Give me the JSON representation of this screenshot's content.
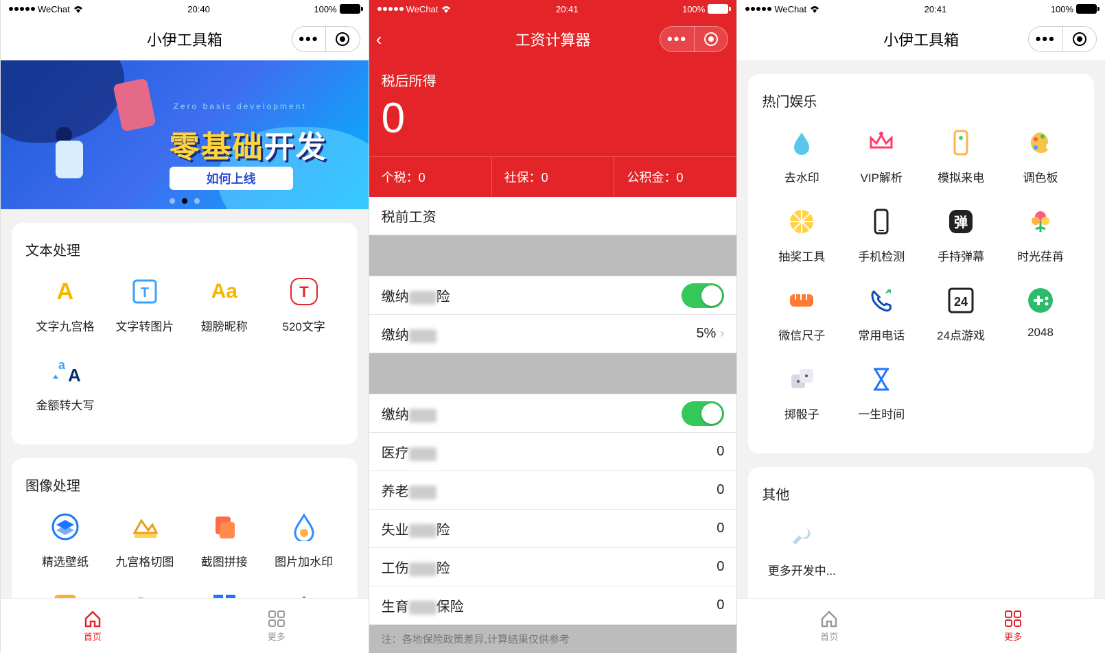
{
  "status": {
    "carrier": "WeChat",
    "time1": "20:40",
    "time2": "20:41",
    "time3": "20:41",
    "battery": "100%"
  },
  "screen1": {
    "title": "小伊工具箱",
    "banner_line1": "零基础",
    "banner_line2": "开发",
    "banner_sub": "Zero basic development",
    "banner_btn": "如何上线",
    "sec1_title": "文本处理",
    "sec1_items": [
      {
        "label": "文字九宫格"
      },
      {
        "label": "文字转图片"
      },
      {
        "label": "翅膀昵称"
      },
      {
        "label": "520文字"
      },
      {
        "label": "金额转大写"
      }
    ],
    "sec2_title": "图像处理",
    "sec2_items": [
      {
        "label": "精选壁纸"
      },
      {
        "label": "九宫格切图"
      },
      {
        "label": "截图拼接"
      },
      {
        "label": "图片加水印"
      }
    ],
    "tabs": {
      "home": "首页",
      "more": "更多"
    }
  },
  "screen2": {
    "title": "工资计算器",
    "net_label": "税后所得",
    "net_value": "0",
    "tax_label": "个税：",
    "tax_value": "0",
    "social_label": "社保：",
    "social_value": "0",
    "fund_label": "公积金：",
    "fund_value": "0",
    "row_pre_salary": "税前工资",
    "row_pay1": "缴纳",
    "row_pay2": "缴纳",
    "row_pay2_val": "5%",
    "row_pay3": "缴纳",
    "row_med": "医疗",
    "row_pension": "养老",
    "row_unemp": "失业",
    "row_injury": "工伤",
    "row_birth": "生育",
    "zero": "0",
    "suffix_ins": "险",
    "suffix_ins2": "保险",
    "note": "注：各地保险政策差异,计算结果仅供参考"
  },
  "screen3": {
    "title": "小伊工具箱",
    "sec1_title": "热门娱乐",
    "sec1_items": [
      {
        "label": "去水印"
      },
      {
        "label": "VIP解析"
      },
      {
        "label": "模拟来电"
      },
      {
        "label": "调色板"
      },
      {
        "label": "抽奖工具"
      },
      {
        "label": "手机检测"
      },
      {
        "label": "手持弹幕"
      },
      {
        "label": "时光荏苒"
      },
      {
        "label": "微信尺子"
      },
      {
        "label": "常用电话"
      },
      {
        "label": "24点游戏"
      },
      {
        "label": "2048"
      },
      {
        "label": "掷骰子"
      },
      {
        "label": "一生时间"
      }
    ],
    "sec2_title": "其他",
    "sec2_item": "更多开发中...",
    "tabs": {
      "home": "首页",
      "more": "更多"
    }
  }
}
